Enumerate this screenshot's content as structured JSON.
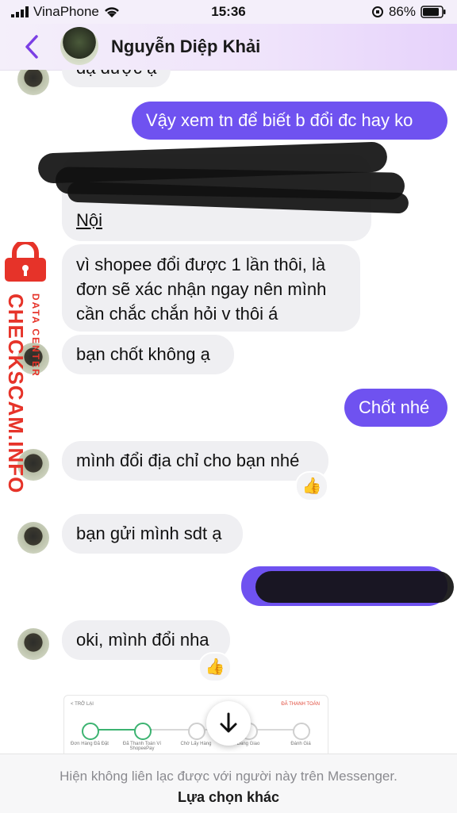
{
  "status_bar": {
    "carrier": "VinaPhone",
    "time": "15:36",
    "battery": "86%"
  },
  "header": {
    "contact_name": "Nguyễn Diệp Khải"
  },
  "messages": [
    {
      "id": "m0",
      "from": "them",
      "text": "dạ được ạ"
    },
    {
      "id": "m1",
      "from": "me",
      "text": "Vậy xem tn để biết b đổi đc hay ko"
    },
    {
      "id": "m2",
      "from": "them",
      "text": "Nội"
    },
    {
      "id": "m3",
      "from": "them",
      "text": "vì shopee đổi được 1 lần  thôi, là đơn sẽ xác nhận ngay nên mình cần chắc chắn hỏi v thôi  á"
    },
    {
      "id": "m4",
      "from": "them",
      "text": "bạn chốt không ạ"
    },
    {
      "id": "m5",
      "from": "me",
      "text": "Chốt nhé"
    },
    {
      "id": "m6",
      "from": "them",
      "text": "mình đổi địa chỉ cho bạn nhé",
      "reaction": "👍"
    },
    {
      "id": "m7",
      "from": "them",
      "text": "bạn gửi mình sdt ạ"
    },
    {
      "id": "m8",
      "from": "them",
      "text": "oki, mình đổi nha",
      "reaction": "👍"
    }
  ],
  "receipt": {
    "back_label": "< TRỞ LẠI",
    "status": "ĐÃ THANH TOÁN",
    "steps": [
      "Đơn Hàng Đã Đặt",
      "Đã Thanh Toán Ví ShopeePay",
      "Chờ Lấy Hàng",
      "Đang Giao",
      "Đánh Giá"
    ]
  },
  "footer": {
    "notice": "Hiện không liên lạc được với người này trên Messenger.",
    "other_options": "Lựa chọn khác"
  },
  "watermark": {
    "main": "CHECKSCAM.INFO",
    "sub": "DATA CENTER"
  },
  "colors": {
    "outgoing_bubble": "#6f52f0",
    "incoming_bubble": "#efeff2",
    "accent": "#7b3fe4",
    "watermark": "#e63329"
  },
  "icons": [
    "signal-icon",
    "wifi-icon",
    "lock-rotation-icon",
    "battery-icon",
    "back-chevron-icon",
    "scroll-down-arrow-icon",
    "thumbs-up-icon",
    "lock-icon"
  ]
}
